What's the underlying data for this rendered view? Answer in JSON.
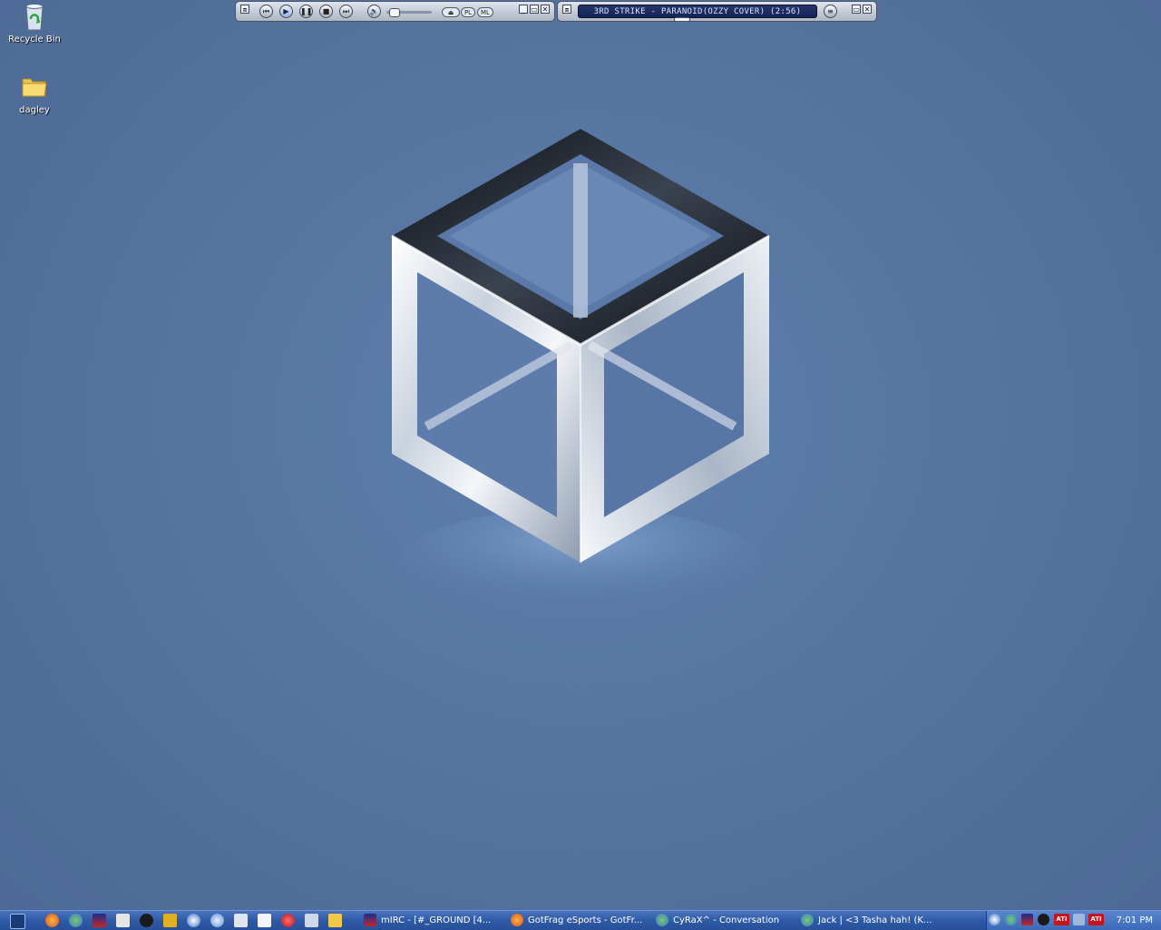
{
  "desktop": {
    "icons": [
      {
        "label": "Recycle Bin",
        "icon": "recycle-bin-icon"
      },
      {
        "label": "dagley",
        "icon": "folder-icon"
      }
    ]
  },
  "winamp": {
    "song_title": "3RD STRIKE - PARANOID(OZZY COVER) (2:56)",
    "pl_label": "PL",
    "ml_label": "ML",
    "buttons": [
      "previous-icon",
      "play-icon",
      "pause-icon",
      "stop-icon",
      "next-icon"
    ],
    "volume_level": 0.1
  },
  "taskbar": {
    "quicklaunch": [
      "show-desktop-icon",
      "firefox-icon",
      "msn-icon",
      "mirc-icon",
      "counter-strike-icon",
      "steam-icon",
      "tools-icon",
      "media-player-icon",
      "messenger-icon",
      "notepad-icon",
      "winamp-icon",
      "apple-icon",
      "chat-icon",
      "folder-icon"
    ],
    "tasks": [
      {
        "label": "mIRC - [#_GROUND [4...",
        "icon": "mirc-icon"
      },
      {
        "label": "GotFrag eSports - GotFr...",
        "icon": "firefox-icon"
      },
      {
        "label": "CyRaX^ - Conversation",
        "icon": "msn-icon"
      },
      {
        "label": "Jack | <3 Tasha hah! (K...",
        "icon": "msn-icon"
      }
    ],
    "tray_icons": [
      "network-icon",
      "msn-tray-icon",
      "mirc-tray-icon",
      "steam-tray-icon",
      "ati-icon",
      "security-icon",
      "ati-icon"
    ],
    "ati_label": "ATI",
    "clock": "7:01 PM"
  },
  "colors": {
    "taskbar": "#2f5aa6",
    "desktop": "#56759f"
  }
}
